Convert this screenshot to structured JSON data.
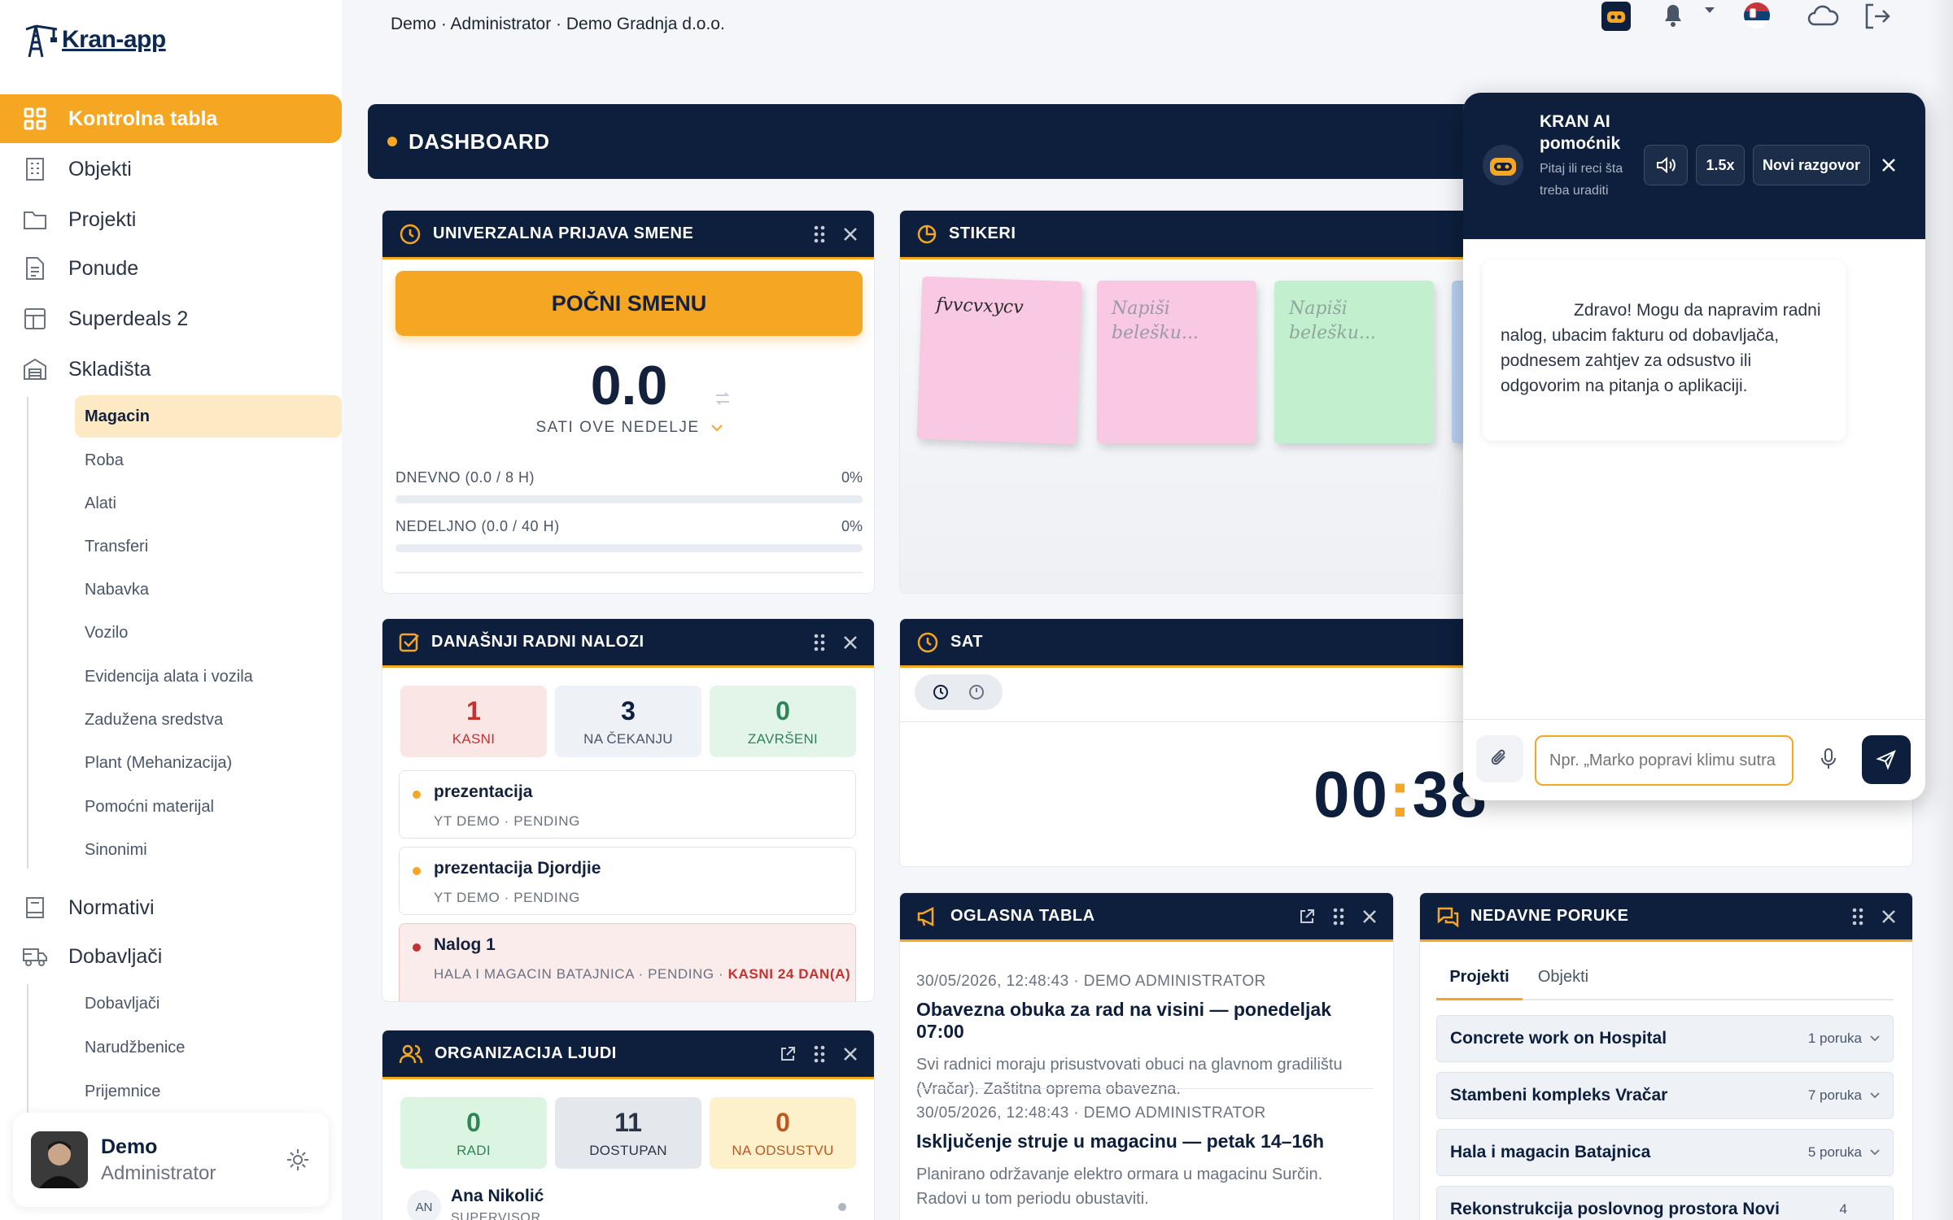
{
  "brand": {
    "name": "Kran-app"
  },
  "breadcrumb": "Demo · Administrator · Demo Gradnja d.o.o.",
  "sidebar": {
    "items": [
      {
        "label": "Kontrolna tabla"
      },
      {
        "label": "Objekti"
      },
      {
        "label": "Projekti"
      },
      {
        "label": "Ponude"
      },
      {
        "label": "Superdeals 2"
      },
      {
        "label": "Skladišta"
      },
      {
        "label": "Normativi"
      },
      {
        "label": "Dobavljači"
      }
    ],
    "warehouse_sub": [
      "Magacin",
      "Roba",
      "Alati",
      "Transferi",
      "Nabavka",
      "Vozilo",
      "Evidencija alata i vozila",
      "Zadužena sredstva",
      "Plant (Mehanizacija)",
      "Pomoćni materijal",
      "Sinonimi"
    ],
    "supplier_sub": [
      "Dobavljači",
      "Narudžbenice",
      "Prijemnice"
    ]
  },
  "user": {
    "name": "Demo",
    "role": "Administrator"
  },
  "dashboard": {
    "title": "DASHBOARD"
  },
  "shift": {
    "title": "UNIVERZALNA PRIJAVA SMENE",
    "button": "POČNI SMENU",
    "hours": "0.0",
    "hours_label": "SATI OVE NEDELJE",
    "daily_label": "DNEVNO (0.0 / 8 H)",
    "daily_pct": "0%",
    "daily_progress": 0,
    "weekly_label": "NEDELJNO (0.0 / 40 H)",
    "weekly_pct": "0%",
    "weekly_progress": 0
  },
  "stickers": {
    "title": "STIKERI",
    "notes": [
      {
        "text": "fvvcvxycv",
        "color": "#f9c8e2"
      },
      {
        "text": "Napiši belešku...",
        "color": "#f9c8e2"
      },
      {
        "text": "Napiši belešku...",
        "color": "#c2f0cf"
      }
    ]
  },
  "orders": {
    "title": "DANAŠNJI RADNI NALOZI",
    "stats": [
      {
        "value": "1",
        "label": "KASNI"
      },
      {
        "value": "3",
        "label": "NA ČEKANJU"
      },
      {
        "value": "0",
        "label": "ZAVRŠENI"
      }
    ],
    "list": [
      {
        "title": "prezentacija",
        "meta": "YT DEMO · PENDING"
      },
      {
        "title": "prezentacija Djordjie",
        "meta": "YT DEMO · PENDING"
      },
      {
        "title": "Nalog 1",
        "meta": "HALA I MAGACIN BATAJNICA · PENDING · ",
        "late": "KASNI 24 DAN(A)"
      }
    ]
  },
  "clock": {
    "title": "SAT",
    "hours": "00",
    "sep": ":",
    "minutes": "38"
  },
  "people": {
    "title": "ORGANIZACIJA LJUDI",
    "stats": [
      {
        "value": "0",
        "label": "RADI"
      },
      {
        "value": "11",
        "label": "DOSTUPAN"
      },
      {
        "value": "0",
        "label": "NA ODSUSTVU"
      }
    ],
    "first": {
      "initials": "AN",
      "name": "Ana Nikolić",
      "role": "SUPERVISOR"
    }
  },
  "board": {
    "title": "OGLASNA TABLA",
    "items": [
      {
        "meta": "30/05/2026, 12:48:43 · DEMO ADMINISTRATOR",
        "title": "Obavezna obuka za rad na visini — ponedeljak 07:00",
        "desc": "Svi radnici moraju prisustvovati obuci na glavnom gradilištu (Vračar). Zaštitna oprema obavezna."
      },
      {
        "meta": "30/05/2026, 12:48:43 · DEMO ADMINISTRATOR",
        "title": "Isključenje struje u magacinu — petak 14–16h",
        "desc": "Planirano održavanje elektro ormara u magacinu Surčin. Radovi u tom periodu obustaviti."
      }
    ]
  },
  "messages": {
    "title": "NEDAVNE PORUKE",
    "tabs": [
      "Projekti",
      "Objekti"
    ],
    "rows": [
      {
        "name": "Concrete work on Hospital",
        "count": "1 poruka"
      },
      {
        "name": "Stambeni kompleks Vračar",
        "count": "7 poruka"
      },
      {
        "name": "Hala i magacin Batajnica",
        "count": "5 poruka"
      },
      {
        "name": "Rekonstrukcija poslovnog prostora Novi",
        "count": "4"
      }
    ]
  },
  "chat": {
    "title": "KRAN AI pomoćnik",
    "subtitle": "Pitaj ili reci šta treba uraditi",
    "speed": "1.5x",
    "new_chat": "Novi razgovor",
    "greeting": "Zdravo! Mogu da napravim radni nalog, ubacim fakturu od dobavljača, podnesem zahtjev za odsustvo ili odgovorim na pitanja o aplikaciji.",
    "placeholder": "Npr. „Marko popravi klimu sutra u Prijedoru\" ili „Kako se..."
  },
  "colors": {
    "accent": "#f5a623",
    "navy": "#0d1f3c",
    "danger": "#c53030",
    "success": "#2f855a"
  }
}
